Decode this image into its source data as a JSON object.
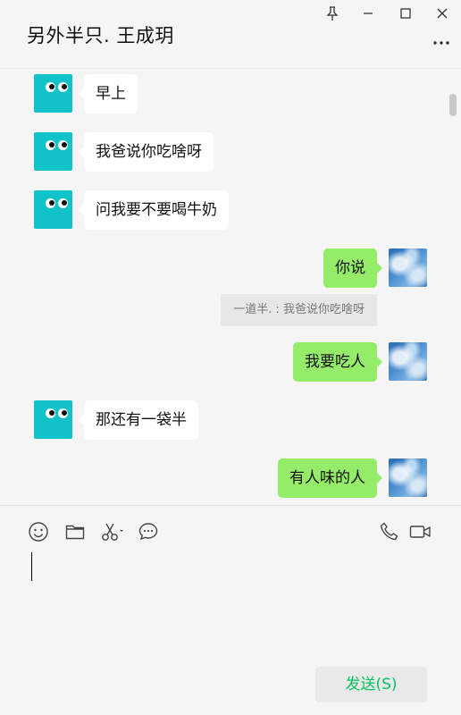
{
  "window": {
    "title": "另外半只. 王成玥",
    "controls": [
      "pin-icon",
      "minimize-icon",
      "maximize-icon",
      "close-icon"
    ],
    "more_icon": "more-dots-icon"
  },
  "messages": [
    {
      "side": "in",
      "text": "早上"
    },
    {
      "side": "in",
      "text": "我爸说你吃啥呀"
    },
    {
      "side": "in",
      "text": "问我要不要喝牛奶"
    },
    {
      "side": "out",
      "text": "你说"
    },
    {
      "side": "quote",
      "text": "一道半. : 我爸说你吃啥呀"
    },
    {
      "side": "out",
      "text": "我要吃人"
    },
    {
      "side": "in",
      "text": "那还有一袋半"
    },
    {
      "side": "out",
      "text": "有人味的人"
    }
  ],
  "toolbar": {
    "left_icons": [
      "emoji-icon",
      "folder-icon",
      "scissors-icon",
      "chat-bubble-icon"
    ],
    "right_icons": [
      "phone-icon",
      "video-call-icon"
    ],
    "send_label": "发送(S)"
  },
  "colors": {
    "background": "#f5f5f5",
    "outgoing_bubble": "#95ec69",
    "incoming_bubble": "#ffffff",
    "bot_avatar": "#11c2c9",
    "send_text": "#07c160"
  }
}
